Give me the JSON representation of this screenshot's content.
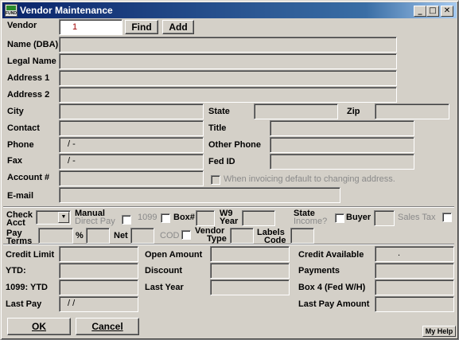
{
  "window": {
    "title": "Vendor Maintenance",
    "icon_text": "FUND",
    "minimize": "_",
    "maximize": "□",
    "close": "✕"
  },
  "vendor": {
    "label": "Vendor",
    "value": "1",
    "find_label": "Find",
    "add_label": "Add"
  },
  "labels": {
    "name_dba": "Name (DBA)",
    "legal_name": "Legal Name",
    "address1": "Address 1",
    "address2": "Address 2",
    "city": "City",
    "state": "State",
    "zip": "Zip",
    "contact": "Contact",
    "title": "Title",
    "phone": "Phone",
    "other_phone": "Other Phone",
    "fax": "Fax",
    "fed_id": "Fed ID",
    "account": "Account #",
    "email": "E-mail",
    "invoice_default": "When invoicing default to changing address."
  },
  "values": {
    "phone": "/  -",
    "fax": "/  -",
    "last_pay": "/ /",
    "credit_available": "."
  },
  "options": {
    "check_acct": [
      "Check",
      "Acct"
    ],
    "manual_direct_pay": [
      "Manual",
      "Direct Pay"
    ],
    "form_1099": "1099",
    "box": "Box#",
    "w9_year": [
      "W9",
      "Year"
    ],
    "state_income": [
      "State",
      "Income?"
    ],
    "buyer": "Buyer",
    "sales_tax": "Sales Tax",
    "pay_terms": [
      "Pay",
      "Terms"
    ],
    "percent": "%",
    "net": "Net",
    "cod": "COD",
    "vendor_type": [
      "Vendor",
      "Type"
    ],
    "labels_code": [
      "Labels",
      "Code"
    ]
  },
  "amounts": {
    "credit_limit": "Credit Limit",
    "ytd": "YTD:",
    "ytd_1099": "1099: YTD",
    "last_pay": "Last Pay",
    "open_amount": "Open Amount",
    "discount": "Discount",
    "last_year": "Last Year",
    "credit_available": "Credit Available",
    "payments": "Payments",
    "box4": "Box 4 (Fed W/H)",
    "last_pay_amount": "Last Pay Amount"
  },
  "buttons": {
    "ok": "OK",
    "cancel": "Cancel",
    "help": "My Help"
  }
}
